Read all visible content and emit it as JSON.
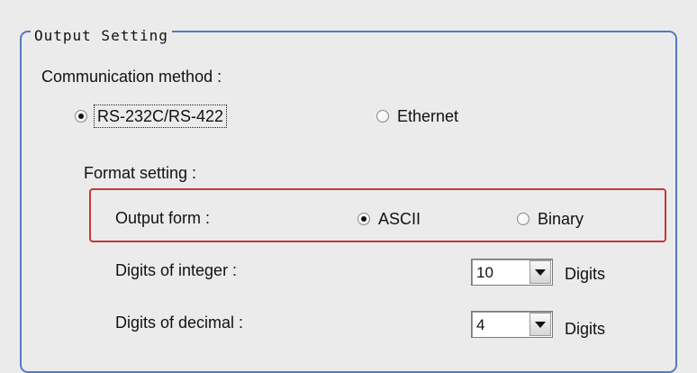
{
  "group": {
    "title": "Output Setting"
  },
  "communication": {
    "label": "Communication method :",
    "options": [
      {
        "label": "RS-232C/RS-422",
        "checked": true
      },
      {
        "label": "Ethernet",
        "checked": false
      }
    ]
  },
  "format": {
    "label": "Format setting :",
    "output_form": {
      "label": "Output form :",
      "options": [
        {
          "label": "ASCII",
          "checked": true
        },
        {
          "label": "Binary",
          "checked": false
        }
      ]
    },
    "digits_integer": {
      "label": "Digits of integer :",
      "value": "10",
      "unit": "Digits"
    },
    "digits_decimal": {
      "label": "Digits of decimal :",
      "value": "4",
      "unit": "Digits"
    }
  }
}
